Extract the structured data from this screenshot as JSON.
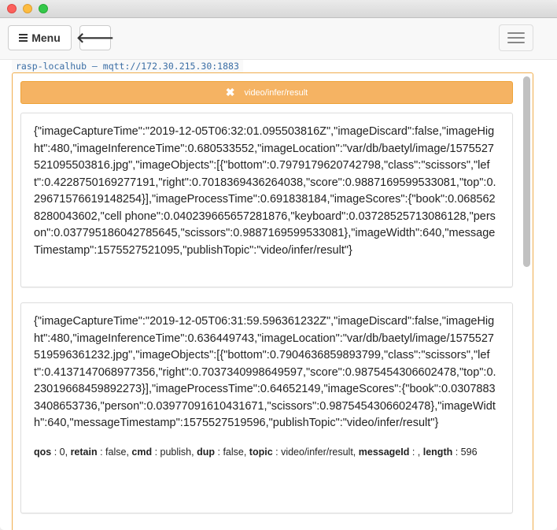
{
  "navbar": {
    "menu_label": "Menu",
    "back_icon": "arrow-left-icon",
    "toggle_icon": "hamburger-icon"
  },
  "host": {
    "label": "rasp-localhub – mqtt://172.30.215.30:1883"
  },
  "topic": {
    "label": "video/infer/result",
    "close_icon": "close-icon",
    "accent_color": "#f5b363"
  },
  "messages": [
    {
      "payload": "{\"imageCaptureTime\":\"2019-12-05T06:32:01.095503816Z\",\"imageDiscard\":false,\"imageHight\":480,\"imageInferenceTime\":0.680533552,\"imageLocation\":\"var/db/baetyl/image/1575527521095503816.jpg\",\"imageObjects\":[{\"bottom\":0.7979179620742798,\"class\":\"scissors\",\"left\":0.4228750169277191,\"right\":0.7018369436264038,\"score\":0.9887169599533081,\"top\":0.29671576619148254}],\"imageProcessTime\":0.691838184,\"imageScores\":{\"book\":0.0685628280043602,\"cell phone\":0.040239665657281876,\"keyboard\":0.03728525713086128,\"person\":0.037795186042785645,\"scissors\":0.9887169599533081},\"imageWidth\":640,\"messageTimestamp\":1575527521095,\"publishTopic\":\"video/infer/result\"}"
    },
    {
      "payload": "{\"imageCaptureTime\":\"2019-12-05T06:31:59.596361232Z\",\"imageDiscard\":false,\"imageHight\":480,\"imageInferenceTime\":0.636449743,\"imageLocation\":\"var/db/baetyl/image/1575527519596361232.jpg\",\"imageObjects\":[{\"bottom\":0.7904636859893799,\"class\":\"scissors\",\"left\":0.4137147068977356,\"right\":0.7037340998649597,\"score\":0.9875454306602478,\"top\":0.23019668459892273}],\"imageProcessTime\":0.64652149,\"imageScores\":{\"book\":0.03078833408653736,\"person\":0.03977091610431671,\"scissors\":0.9875454306602478},\"imageWidth\":640,\"messageTimestamp\":1575527519596,\"publishTopic\":\"video/infer/result\"}",
      "meta": {
        "qos_key": "qos",
        "qos": "0",
        "retain_key": "retain",
        "retain": "false",
        "cmd_key": "cmd",
        "cmd": "publish",
        "dup_key": "dup",
        "dup": "false",
        "topic_key": "topic",
        "topic": "video/infer/result",
        "messageId_key": "messageId",
        "messageId": "",
        "length_key": "length",
        "length": "596"
      }
    }
  ]
}
